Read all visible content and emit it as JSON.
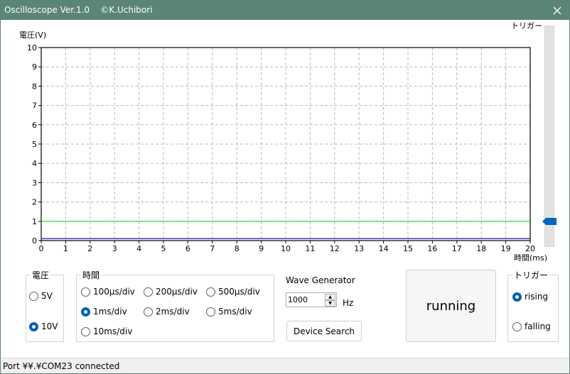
{
  "window": {
    "title": "Oscilloscope Ver.1.0    ©K.Uchibori",
    "accent_color": "#5b8575"
  },
  "chart_data": {
    "type": "line",
    "ylabel": "電圧(V)",
    "xlabel": "時間(ms)",
    "xlim": [
      0,
      20
    ],
    "ylim": [
      0,
      10
    ],
    "x_ticks": [
      "0",
      "1",
      "2",
      "3",
      "4",
      "5",
      "6",
      "7",
      "8",
      "9",
      "10",
      "11",
      "12",
      "13",
      "14",
      "15",
      "16",
      "17",
      "18",
      "19",
      "20"
    ],
    "y_ticks": [
      "0",
      "1",
      "2",
      "3",
      "4",
      "5",
      "6",
      "7",
      "8",
      "9",
      "10"
    ],
    "grid": true,
    "series": [
      {
        "color": "#32cd32",
        "x": [
          0,
          20
        ],
        "y": [
          1.0,
          1.0
        ]
      },
      {
        "color": "#1a1aaa",
        "x": [
          0,
          20
        ],
        "y": [
          0.1,
          0.1
        ]
      }
    ]
  },
  "trigger_slider": {
    "label": "トリガー",
    "value": 1.0
  },
  "voltage_group": {
    "label": "電圧",
    "options": [
      {
        "label": "5V",
        "checked": false
      },
      {
        "label": "10V",
        "checked": true
      }
    ]
  },
  "time_group": {
    "label": "時間",
    "options": [
      {
        "label": "100µs/div",
        "checked": false
      },
      {
        "label": "200µs/div",
        "checked": false
      },
      {
        "label": "500µs/div",
        "checked": false
      },
      {
        "label": "1ms/div",
        "checked": true
      },
      {
        "label": "2ms/div",
        "checked": false
      },
      {
        "label": "5ms/div",
        "checked": false
      },
      {
        "label": "10ms/div",
        "checked": false
      }
    ]
  },
  "wave_generator": {
    "label": "Wave Generator",
    "frequency": "1000",
    "unit": "Hz",
    "device_search_label": "Device Search"
  },
  "run_button": {
    "label": "running"
  },
  "trigger_group": {
    "label": "トリガー",
    "options": [
      {
        "label": "rising",
        "checked": true
      },
      {
        "label": "falling",
        "checked": false
      }
    ]
  },
  "status": {
    "text": "Port ¥¥.¥COM23 connected"
  }
}
